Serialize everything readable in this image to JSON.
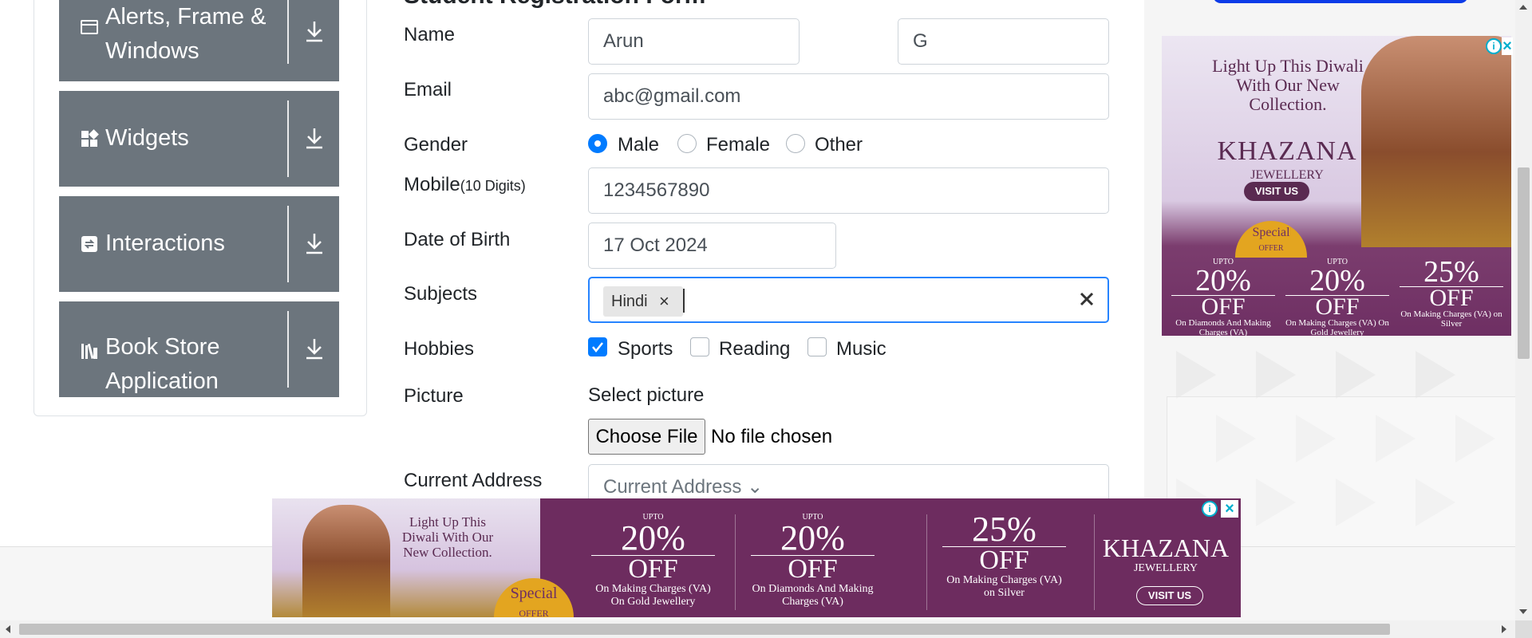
{
  "sidebar": {
    "groups": [
      {
        "label_line1": "Alerts, Frame &",
        "label_line2": "Windows",
        "icon": "window-icon"
      },
      {
        "label": "Widgets",
        "icon": "widgets-icon"
      },
      {
        "label": "Interactions",
        "icon": "interactions-icon"
      },
      {
        "label_line1": "Book Store",
        "label_line2": "Application",
        "icon": "book-icon"
      }
    ]
  },
  "form": {
    "title": "Student Registration Form",
    "labels": {
      "name": "Name",
      "email": "Email",
      "gender": "Gender",
      "mobile": "Mobile",
      "mobile_hint": "(10 Digits)",
      "dob": "Date of Birth",
      "subjects": "Subjects",
      "hobbies": "Hobbies",
      "picture": "Picture",
      "current_address": "Current Address"
    },
    "first_name": "Arun",
    "last_name": "G",
    "email": "abc@gmail.com",
    "gender_options": [
      "Male",
      "Female",
      "Other"
    ],
    "gender_selected": "Male",
    "mobile": "1234567890",
    "dob": "17 Oct 2024",
    "subjects": [
      {
        "label": "Hindi",
        "remove": "×"
      }
    ],
    "hobbies": [
      "Sports",
      "Reading",
      "Music"
    ],
    "hobbies_checked": [
      "Sports"
    ],
    "select_picture": "Select picture",
    "choose_file": "Choose File",
    "file_status": "No file chosen",
    "current_address_placeholder": "Current Address"
  },
  "ads": {
    "side": {
      "headline": "Light Up This Diwali With Our New Collection.",
      "brand": "KHAZANA",
      "brand_sub": "JEWELLERY",
      "visit": "VISIT US",
      "special": "Special",
      "special_sub": "OFFER",
      "offers": [
        {
          "upto": "UPTO",
          "value": "20%",
          "off": "OFF",
          "caption": "On Diamonds And Making Charges (VA)"
        },
        {
          "upto": "UPTO",
          "value": "20%",
          "off": "OFF",
          "caption": "On Making Charges (VA) On Gold Jewellery"
        },
        {
          "upto": "",
          "value": "25%",
          "off": "OFF",
          "caption": "On Making Charges (VA) on Silver"
        }
      ],
      "info": "i",
      "close": "×"
    },
    "bottom": {
      "headline": "Light Up This Diwali With Our New Collection.",
      "brand": "KHAZANA",
      "brand_sub": "JEWELLERY",
      "visit": "VISIT US",
      "special": "Special",
      "special_sub": "OFFER",
      "offers": [
        {
          "upto": "UPTO",
          "value": "20%",
          "off": "OFF",
          "caption": "On Making Charges (VA) On Gold Jewellery"
        },
        {
          "upto": "UPTO",
          "value": "20%",
          "off": "OFF",
          "caption": "On Diamonds And Making Charges (VA)"
        },
        {
          "upto": "",
          "value": "25%",
          "off": "OFF",
          "caption": "On Making Charges (VA) on Silver"
        }
      ],
      "info": "i",
      "close": "×"
    }
  },
  "colors": {
    "menu_bg": "#6c757d",
    "accent": "#007bff",
    "focus_border": "#2684ff",
    "ad_purple": "#6d2c5f"
  }
}
